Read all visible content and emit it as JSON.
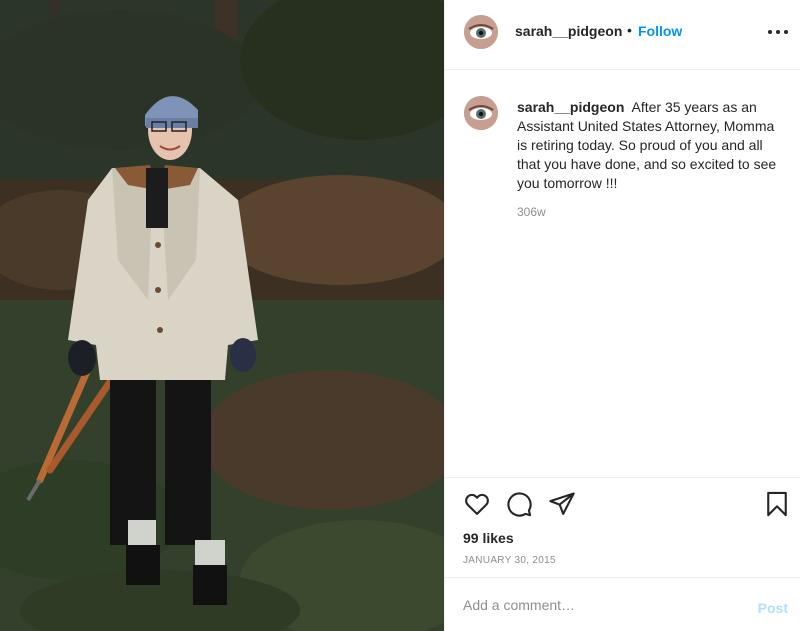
{
  "post": {
    "image_alt": "Woman in a light coat and knit hat holding loppers in a wooded garden",
    "username": "sarah__pidgeon",
    "follow_label": "Follow",
    "separator": "•",
    "more_icon": "more-horizontal-icon"
  },
  "caption": {
    "username": "sarah__pidgeon",
    "text": "After 35 years as an Assistant United States Attorney, Momma is retiring today. So proud of you and all that you have done, and so excited to see you tomorrow !!!",
    "time_ago": "306w"
  },
  "actions": {
    "icons": [
      "heart-icon",
      "comment-icon",
      "share-icon",
      "bookmark-icon"
    ],
    "likes": "99 likes",
    "date": "JANUARY 30, 2015"
  },
  "add_comment": {
    "placeholder": "Add a comment…",
    "post_label": "Post",
    "post_color": "#b2dffc"
  },
  "colors": {
    "accent": "#0095f6",
    "muted": "#8e8e8e",
    "text": "#262626",
    "border": "#efefef"
  }
}
